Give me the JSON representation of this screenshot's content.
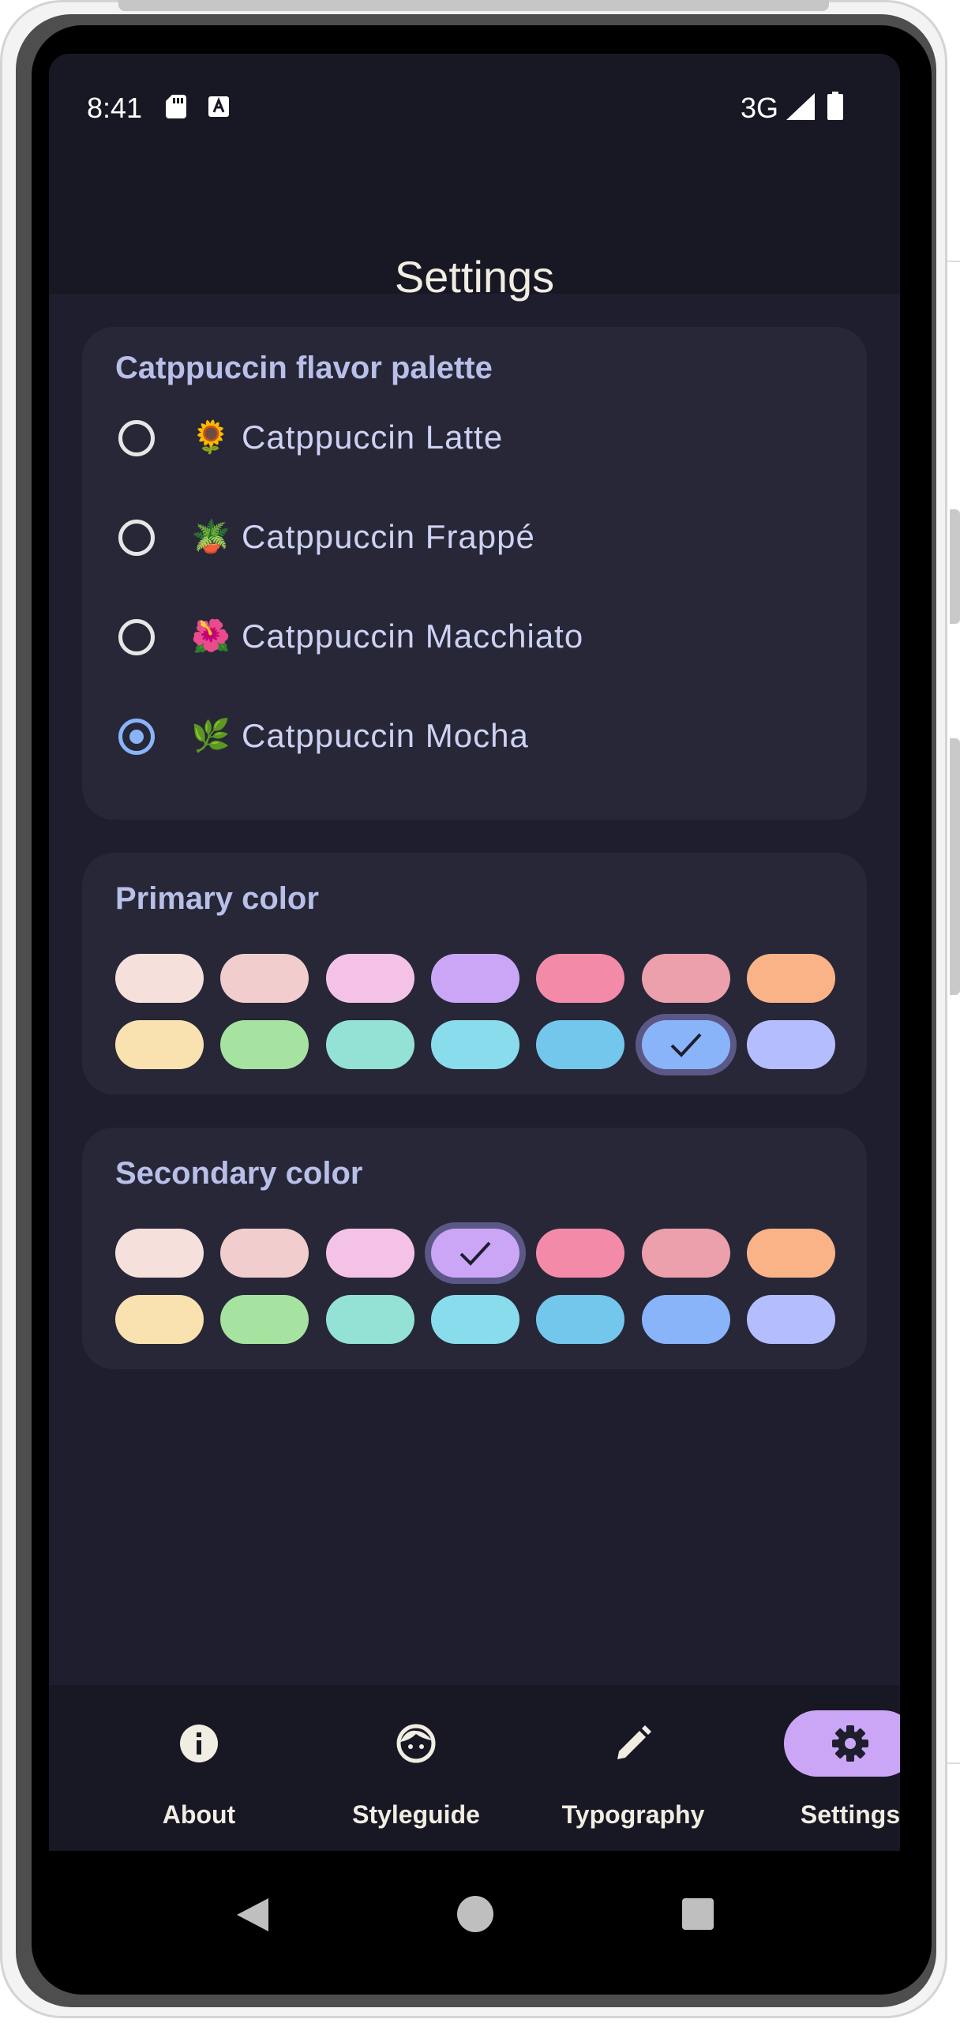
{
  "status_bar": {
    "time": "8:41",
    "network": "3G",
    "icons": [
      "sd-card-icon",
      "text-a-icon",
      "signal-icon",
      "battery-icon"
    ]
  },
  "header": {
    "title": "Settings"
  },
  "flavor_card": {
    "title": "Catppuccin flavor palette",
    "options": [
      {
        "emoji": "🌻",
        "label": "Catppuccin Latte",
        "selected": false
      },
      {
        "emoji": "🪴",
        "label": "Catppuccin Frappé",
        "selected": false
      },
      {
        "emoji": "🌺",
        "label": "Catppuccin Macchiato",
        "selected": false
      },
      {
        "emoji": "🌿",
        "label": "Catppuccin Mocha",
        "selected": true
      }
    ]
  },
  "primary_card": {
    "title": "Primary color",
    "selected_index": 12
  },
  "secondary_card": {
    "title": "Secondary color",
    "selected_index": 3
  },
  "palette": [
    "#f5e0dc",
    "#f2cdcd",
    "#f5c2e7",
    "#cba6f7",
    "#f38ba8",
    "#eba0ac",
    "#fab387",
    "#f9e2af",
    "#a6e3a1",
    "#94e2d5",
    "#89dceb",
    "#74c7ec",
    "#89b4fa",
    "#b4befe"
  ],
  "bottom_nav": {
    "items": [
      {
        "label": "About",
        "icon": "info-icon",
        "active": false
      },
      {
        "label": "Styleguide",
        "icon": "face-icon",
        "active": false
      },
      {
        "label": "Typography",
        "icon": "pencil-icon",
        "active": false
      },
      {
        "label": "Settings",
        "icon": "gear-icon",
        "active": true
      }
    ]
  },
  "colors": {
    "background": "#1e1e2e",
    "surface": "#272738",
    "bar": "#181825",
    "accent": "#cba6f7",
    "radio_selected": "#89b4fa"
  }
}
